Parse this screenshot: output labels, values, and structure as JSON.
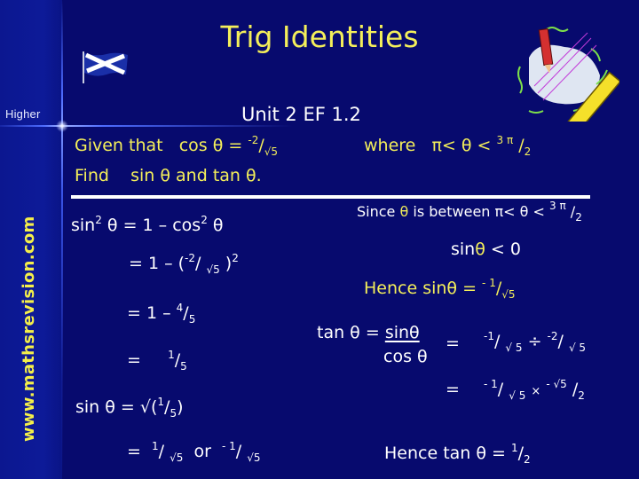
{
  "slide": {
    "title": "Trig Identities",
    "level_label": "Higher",
    "site_label": "www.mathsrevision.com",
    "unit_label": "Unit 2 EF 1.2",
    "icons": {
      "flag": "scottish-flag-icon",
      "clipart": "ruler-pencil-clipart"
    },
    "colors": {
      "background": "#070a6e",
      "highlight_text": "#f4ef5a",
      "body_text": "#ffffff"
    }
  },
  "question": {
    "given_prefix": "Given that",
    "given_func": "cos θ  =",
    "given_num": "-2",
    "given_den": "√5",
    "where_label": "where",
    "range_left": "π< θ <",
    "range_num": "3 π",
    "range_den": "2",
    "find_label": "Find",
    "find_text": "sin θ and   tan θ."
  },
  "left_working": {
    "line1_a": "sin",
    "line1_exp": "2",
    "line1_b": "θ =  1 – cos",
    "line1_exp2": "2",
    "line1_c": "θ",
    "line2_a": "=  1 – (",
    "line2_num": "-2",
    "line2_den": "√5",
    "line2_b": ")",
    "line2_exp": "2",
    "line3_a": "=  1 –",
    "line3_num": "4",
    "line3_den": "5",
    "line4_a": "=",
    "line4_num": "1",
    "line4_den": "5",
    "line5_a": "sin θ = √(",
    "line5_num": "1",
    "line5_den": "5",
    "line5_b": ")",
    "line6_a": "=",
    "line6_num1": "1",
    "line6_den1": "√5",
    "line6_or": "or",
    "line6_num2": "- 1",
    "line6_den2": "√5"
  },
  "right_working": {
    "since_a": "Since",
    "since_theta": "θ",
    "since_b": "is between  π< θ <",
    "since_num": "3 π",
    "since_den": "2",
    "sign_a": "sin",
    "sign_theta": "θ",
    "sign_b": "< 0",
    "hence_sin_a": "Hence   sinθ  =",
    "hence_sin_num": "- 1",
    "hence_sin_den": "√5",
    "tan_def_a": "tan θ =",
    "tan_def_num": "sinθ",
    "tan_def_den": "cos θ",
    "eq1": "=",
    "step1_num1": "-1",
    "step1_den1": "√ 5",
    "step1_op": "÷",
    "step1_num2": "-2",
    "step1_den2": "√ 5",
    "eq2": "=",
    "step2_num1": "- 1",
    "step2_den1": "√ 5",
    "step2_op": "×",
    "step2_num2": "- √5",
    "step2_den2": "2",
    "hence_tan_a": "Hence  tan θ  =",
    "hence_tan_num": "1",
    "hence_tan_den": "2"
  }
}
